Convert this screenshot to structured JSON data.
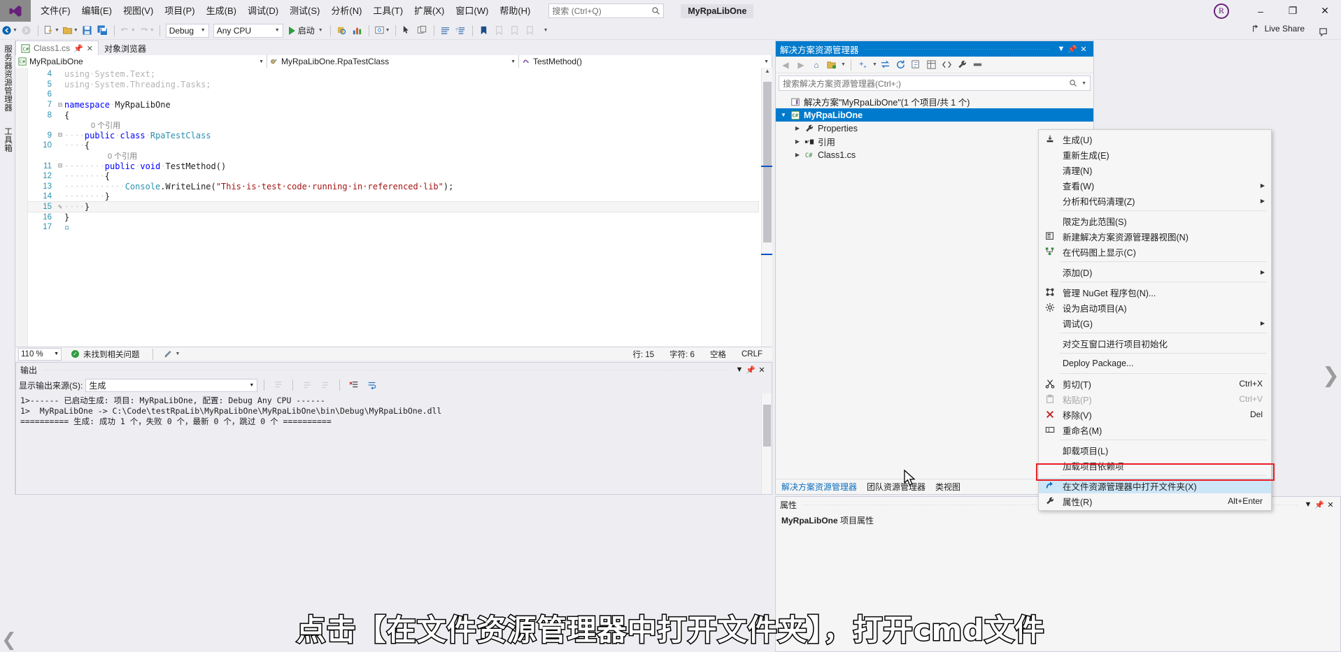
{
  "titlebar": {
    "menus": [
      {
        "label": "文件(F)",
        "name": "menu-file"
      },
      {
        "label": "编辑(E)",
        "name": "menu-edit"
      },
      {
        "label": "视图(V)",
        "name": "menu-view"
      },
      {
        "label": "项目(P)",
        "name": "menu-project"
      },
      {
        "label": "生成(B)",
        "name": "menu-build"
      },
      {
        "label": "调试(D)",
        "name": "menu-debug"
      },
      {
        "label": "测试(S)",
        "name": "menu-test"
      },
      {
        "label": "分析(N)",
        "name": "menu-analyze"
      },
      {
        "label": "工具(T)",
        "name": "menu-tools"
      },
      {
        "label": "扩展(X)",
        "name": "menu-extensions"
      },
      {
        "label": "窗口(W)",
        "name": "menu-window"
      },
      {
        "label": "帮助(H)",
        "name": "menu-help"
      }
    ],
    "search_placeholder": "搜索 (Ctrl+Q)",
    "window_title": "MyRpaLibOne",
    "account_initial": "R",
    "minimize": "–",
    "restore": "❐",
    "close": "✕"
  },
  "toolbar": {
    "config": "Debug",
    "platform": "Any CPU",
    "start_label": "启动",
    "live_share": "Live Share"
  },
  "leftrail": {
    "vertical_tab": "服务器资源管理器",
    "vertical_tab2": "工具箱"
  },
  "editor": {
    "tabs": [
      {
        "label": "Class1.cs",
        "active": true
      },
      {
        "label": "对象浏览器",
        "active": false
      }
    ],
    "nav_left": "MyRpaLibOne",
    "nav_mid": "MyRpaLibOne.RpaTestClass",
    "nav_right": "TestMethod()",
    "lines": [
      {
        "no": "4",
        "glyph": "",
        "indent": 0,
        "ref": "",
        "segs": [
          {
            "t": "using",
            "c": "k-fade"
          },
          {
            "t": "·",
            "c": "dot"
          },
          {
            "t": "System.Text;",
            "c": "fade"
          }
        ]
      },
      {
        "no": "5",
        "glyph": "",
        "indent": 0,
        "ref": "",
        "segs": [
          {
            "t": "using",
            "c": "k-fade"
          },
          {
            "t": "·",
            "c": "dot"
          },
          {
            "t": "System.Threading.Tasks;",
            "c": "fade"
          }
        ]
      },
      {
        "no": "6",
        "glyph": "",
        "indent": 0,
        "ref": "",
        "segs": []
      },
      {
        "no": "7",
        "glyph": "⊟",
        "indent": 0,
        "ref": "",
        "segs": [
          {
            "t": "namespace",
            "c": "k"
          },
          {
            "t": "·",
            "c": "dot"
          },
          {
            "t": "MyRpaLibOne",
            "c": "plain"
          }
        ]
      },
      {
        "no": "8",
        "glyph": "",
        "indent": 0,
        "ref": "",
        "segs": [
          {
            "t": "{",
            "c": "plain"
          }
        ]
      },
      {
        "no": "",
        "glyph": "",
        "indent": 0,
        "ref": "0 个引用",
        "segs": []
      },
      {
        "no": "9",
        "glyph": "⊟",
        "indent": 0,
        "ref": "",
        "segs": [
          {
            "t": "····",
            "c": "dot"
          },
          {
            "t": "public",
            "c": "k"
          },
          {
            "t": "·",
            "c": "dot"
          },
          {
            "t": "class",
            "c": "k"
          },
          {
            "t": "·",
            "c": "dot"
          },
          {
            "t": "RpaTestClass",
            "c": "t"
          }
        ]
      },
      {
        "no": "10",
        "glyph": "",
        "indent": 0,
        "ref": "",
        "segs": [
          {
            "t": "····",
            "c": "dot"
          },
          {
            "t": "{",
            "c": "plain"
          }
        ]
      },
      {
        "no": "",
        "glyph": "",
        "indent": 1,
        "ref": "0 个引用",
        "segs": []
      },
      {
        "no": "11",
        "glyph": "⊟",
        "indent": 0,
        "ref": "",
        "segs": [
          {
            "t": "········",
            "c": "dot"
          },
          {
            "t": "public",
            "c": "k"
          },
          {
            "t": "·",
            "c": "dot"
          },
          {
            "t": "void",
            "c": "k"
          },
          {
            "t": "·",
            "c": "dot"
          },
          {
            "t": "TestMethod()",
            "c": "plain"
          }
        ]
      },
      {
        "no": "12",
        "glyph": "",
        "indent": 0,
        "ref": "",
        "segs": [
          {
            "t": "········",
            "c": "dot"
          },
          {
            "t": "{",
            "c": "plain"
          }
        ]
      },
      {
        "no": "13",
        "glyph": "",
        "indent": 0,
        "ref": "",
        "segs": [
          {
            "t": "············",
            "c": "dot"
          },
          {
            "t": "Console",
            "c": "t"
          },
          {
            "t": ".WriteLine(",
            "c": "plain"
          },
          {
            "t": "\"This·is·test·code·running·in·referenced·lib\"",
            "c": "s"
          },
          {
            "t": ");",
            "c": "plain"
          }
        ]
      },
      {
        "no": "14",
        "glyph": "",
        "indent": 0,
        "ref": "",
        "segs": [
          {
            "t": "········",
            "c": "dot"
          },
          {
            "t": "}",
            "c": "plain"
          }
        ]
      },
      {
        "no": "15",
        "glyph": "✎",
        "indent": 0,
        "ref": "",
        "hl": true,
        "segs": [
          {
            "t": "····",
            "c": "dot"
          },
          {
            "t": "}",
            "c": "plain"
          }
        ]
      },
      {
        "no": "16",
        "glyph": "",
        "indent": 0,
        "ref": "",
        "segs": [
          {
            "t": "}",
            "c": "plain"
          }
        ]
      },
      {
        "no": "17",
        "glyph": "",
        "indent": 0,
        "ref": "",
        "segs": [
          {
            "t": "▫",
            "c": "t"
          }
        ]
      }
    ],
    "status": {
      "zoom": "110 %",
      "issues": "未找到相关问题",
      "line_label": "行: 15",
      "char_label": "字符: 6",
      "spaces": "空格",
      "eol": "CRLF"
    }
  },
  "output": {
    "title": "输出",
    "source_label": "显示输出来源(S):",
    "source_value": "生成",
    "lines": [
      "1>------ 已启动生成: 项目: MyRpaLibOne, 配置: Debug Any CPU ------",
      "1>  MyRpaLibOne -> C:\\Code\\testRpaLib\\MyRpaLibOne\\MyRpaLibOne\\bin\\Debug\\MyRpaLibOne.dll",
      "========== 生成: 成功 1 个，失败 0 个，最新 0 个，跳过 0 个 =========="
    ]
  },
  "solution_explorer": {
    "title": "解决方案资源管理器",
    "search_placeholder": "搜索解决方案资源管理器(Ctrl+;)",
    "solution_row": "解决方案\"MyRpaLibOne\"(1 个项目/共 1 个)",
    "project_row": "MyRpaLibOne",
    "children": [
      {
        "label": "Properties",
        "icon": "wrench-icon"
      },
      {
        "label": "引用",
        "icon": "references-icon"
      },
      {
        "label": "Class1.cs",
        "icon": "csharp-file-icon"
      }
    ],
    "bottom_tabs": [
      {
        "label": "解决方案资源管理器",
        "active": true
      },
      {
        "label": "团队资源管理器",
        "active": false
      },
      {
        "label": "类视图",
        "active": false
      }
    ]
  },
  "properties": {
    "title": "属性",
    "subject_bold": "MyRpaLibOne",
    "subject_rest": " 项目属性"
  },
  "context_menu": {
    "items": [
      {
        "label": "生成(U)",
        "icon": "build-icon",
        "shortcut": "",
        "arrow": false
      },
      {
        "label": "重新生成(E)",
        "icon": "",
        "shortcut": "",
        "arrow": false
      },
      {
        "label": "清理(N)",
        "icon": "",
        "shortcut": "",
        "arrow": false
      },
      {
        "label": "查看(W)",
        "icon": "",
        "shortcut": "",
        "arrow": true
      },
      {
        "label": "分析和代码清理(Z)",
        "icon": "",
        "shortcut": "",
        "arrow": true
      },
      {
        "sep": true
      },
      {
        "label": "限定为此范围(S)",
        "icon": "",
        "shortcut": "",
        "arrow": false
      },
      {
        "label": "新建解决方案资源管理器视图(N)",
        "icon": "new-view-icon",
        "shortcut": "",
        "arrow": false
      },
      {
        "label": "在代码图上显示(C)",
        "icon": "codemap-icon",
        "shortcut": "",
        "arrow": false
      },
      {
        "sep": true
      },
      {
        "label": "添加(D)",
        "icon": "",
        "shortcut": "",
        "arrow": true
      },
      {
        "sep": true
      },
      {
        "label": "管理 NuGet 程序包(N)...",
        "icon": "nuget-icon",
        "shortcut": "",
        "arrow": false
      },
      {
        "label": "设为启动项目(A)",
        "icon": "gear-icon",
        "shortcut": "",
        "arrow": false
      },
      {
        "label": "调试(G)",
        "icon": "",
        "shortcut": "",
        "arrow": true
      },
      {
        "sep": true
      },
      {
        "label": "对交互窗口进行项目初始化",
        "icon": "",
        "shortcut": "",
        "arrow": false
      },
      {
        "sep": true
      },
      {
        "label": "Deploy Package...",
        "icon": "",
        "shortcut": "",
        "arrow": false
      },
      {
        "sep": true
      },
      {
        "label": "剪切(T)",
        "icon": "scissors-icon",
        "shortcut": "Ctrl+X",
        "arrow": false
      },
      {
        "label": "粘贴(P)",
        "icon": "clipboard-icon",
        "shortcut": "Ctrl+V",
        "arrow": false,
        "disabled": true
      },
      {
        "label": "移除(V)",
        "icon": "x-red-icon",
        "shortcut": "Del",
        "arrow": false
      },
      {
        "label": "重命名(M)",
        "icon": "rename-icon",
        "shortcut": "",
        "arrow": false
      },
      {
        "sep": true
      },
      {
        "label": "卸载项目(L)",
        "icon": "",
        "shortcut": "",
        "arrow": false
      },
      {
        "label": "加载项目依赖项",
        "icon": "",
        "shortcut": "",
        "arrow": false
      },
      {
        "sep": true
      },
      {
        "label": "在文件资源管理器中打开文件夹(X)",
        "icon": "open-folder-icon",
        "shortcut": "",
        "arrow": false,
        "highlight": true
      },
      {
        "label": "属性(R)",
        "icon": "wrench-icon",
        "shortcut": "Alt+Enter",
        "arrow": false
      }
    ]
  },
  "subtitle": {
    "text": "点击【在文件资源管理器中打开文件夹】，打开cmd文件"
  },
  "colors": {
    "accent_blue": "#007acc",
    "highlight_red": "#ed1c24",
    "menu_highlight": "#cde6f7",
    "vs_purple": "#68217a"
  }
}
